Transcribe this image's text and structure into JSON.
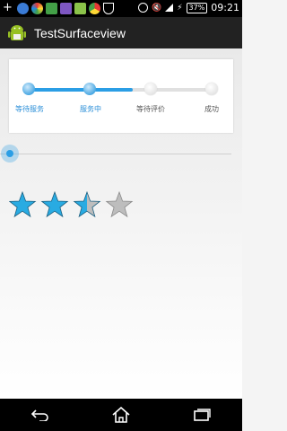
{
  "status_bar": {
    "battery": "37%",
    "time": "09:21"
  },
  "action_bar": {
    "title": "TestSurfaceview"
  },
  "steps": [
    {
      "label": "等待服务",
      "state": "done"
    },
    {
      "label": "服务中",
      "state": "done"
    },
    {
      "label": "等待评价",
      "state": "todo"
    },
    {
      "label": "成功",
      "state": "todo"
    }
  ],
  "step_progress": 0.55,
  "seek_bar": {
    "value": 0
  },
  "rating": {
    "value": 2.5,
    "max": 4
  },
  "colors": {
    "accent": "#2b9ee5",
    "star_filled": "#29abe2",
    "star_empty": "#bdbdbd"
  },
  "nav_bar": {
    "icons": [
      "back-icon",
      "home-icon",
      "recents-icon"
    ]
  }
}
